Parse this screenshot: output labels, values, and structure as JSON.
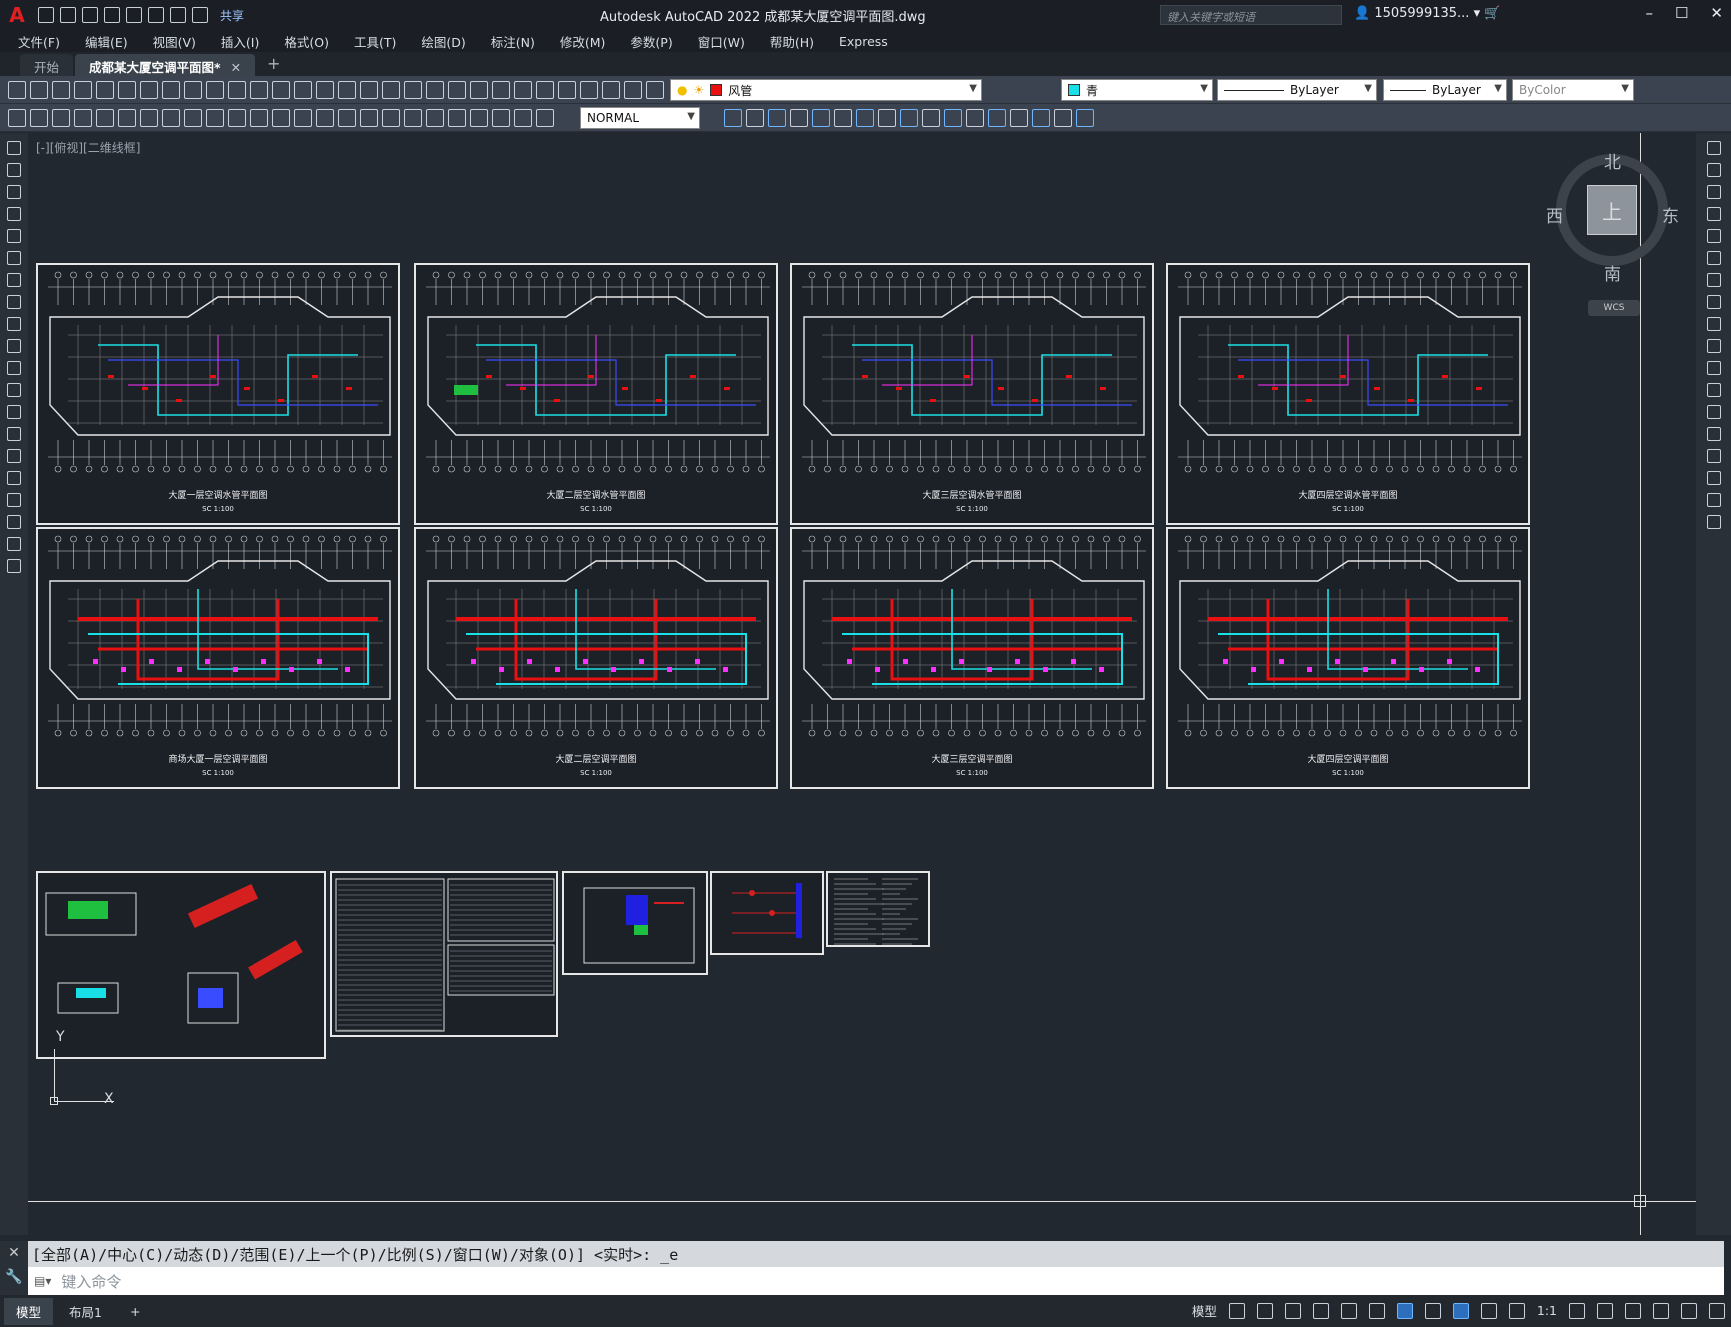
{
  "title_bar": {
    "app_title": "Autodesk AutoCAD 2022    成都某大厦空调平面图.dwg",
    "share_label": "共享",
    "search_placeholder": "键入关键字或短语",
    "user_name": "1505999135...",
    "window_controls": [
      "minimize-icon",
      "restore-icon",
      "close-icon"
    ]
  },
  "menu": {
    "items": [
      "文件(F)",
      "编辑(E)",
      "视图(V)",
      "插入(I)",
      "格式(O)",
      "工具(T)",
      "绘图(D)",
      "标注(N)",
      "修改(M)",
      "参数(P)",
      "窗口(W)",
      "帮助(H)",
      "Express"
    ]
  },
  "tabs": {
    "start": "开始",
    "drawing": "成都某大厦空调平面图*"
  },
  "properties": {
    "layer": "风管",
    "layer_color": "#e81010",
    "color": "青",
    "color_swatch": "#19e0e6",
    "linetype": "ByLayer",
    "lineweight": "ByLayer",
    "plotstyle": "ByColor",
    "dimstyle": "NORMAL"
  },
  "viewport": {
    "label": "[-][俯视][二维线框]",
    "compass": {
      "north": "北",
      "south": "南",
      "east": "东",
      "west": "西",
      "top": "上"
    },
    "wcs": "WCS"
  },
  "sheets": [
    {
      "caption": "大厦一层空调水管平面图",
      "scale": "SC  1:100"
    },
    {
      "caption": "大厦二层空调水管平面图",
      "scale": "SC  1:100"
    },
    {
      "caption": "大厦三层空调水管平面图",
      "scale": "SC  1:100"
    },
    {
      "caption": "大厦四层空调水管平面图",
      "scale": "SC  1:100"
    },
    {
      "caption": "商场大厦一层空调平面图",
      "scale": "SC  1:100"
    },
    {
      "caption": "大厦二层空调平面图",
      "scale": "SC  1:100"
    },
    {
      "caption": "大厦三层空调平面图",
      "scale": "SC  1:100"
    },
    {
      "caption": "大厦四层空调平面图",
      "scale": "SC  1:100"
    }
  ],
  "ucs": {
    "x": "X",
    "y": "Y"
  },
  "command": {
    "history": "[全部(A)/中心(C)/动态(D)/范围(E)/上一个(P)/比例(S)/窗口(W)/对象(O)] <实时>: _e",
    "placeholder": "键入命令"
  },
  "status": {
    "tabs": [
      "模型",
      "布局1"
    ],
    "model_label": "模型",
    "scale": "1:1"
  }
}
